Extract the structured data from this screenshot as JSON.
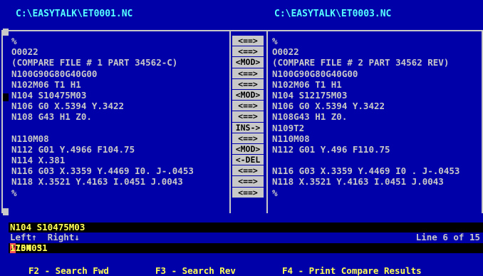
{
  "titles": {
    "left": "C:\\EASYTALK\\ET0001.NC",
    "right": "C:\\EASYTALK\\ET0003.NC"
  },
  "left_lines": [
    "%",
    "O0022",
    "(COMPARE FILE # 1 PART 34562-C)",
    "N100G90G80G40G00",
    "N102M06 T1 H1",
    "N104 S10475M03",
    "N106 G0 X.5394 Y.3422",
    "N108 G43 H1 Z0.",
    "",
    "N110M08",
    "N112 G01 Y.4966 F104.75",
    "N114 X.381",
    "N116 G03 X.3359 Y.4469 I0. J-.0453",
    "N118 X.3521 Y.4163 I.0451 J.0043",
    "%"
  ],
  "compare_markers": [
    "<==>",
    "<==>",
    "<MOD>",
    "<==>",
    "<==>",
    "<MOD>",
    "<==>",
    "<==>",
    "INS->",
    "<==>",
    "<MOD>",
    "<-DEL",
    "<==>",
    "<==>",
    "<==>"
  ],
  "right_lines": [
    "%",
    "O0022",
    "(COMPARE FILE # 2 PART 34562 REV)",
    "N100G90G80G40G00",
    "N102M06 T1 H1",
    "N104 S12175M03",
    "N106 G0 X.5394 Y.3422",
    "N108G43 H1 Z0.",
    "N109T2",
    "N110M08",
    "N112 G01 Y.496 F110.75",
    "",
    "N116 G03 X.3359 Y.4469 I0 . J-.0453",
    "N118 X.3521 Y.4163 I.0451 J.0043",
    "%"
  ],
  "status": {
    "top_line": "N104 S10475M03",
    "hint": "Left↑  Right↓",
    "line_info": "Line 6 of 15",
    "bottom_prefix": "N104 S1",
    "bottom_highlight": "2",
    "bottom_suffix": "175M03"
  },
  "function_keys": {
    "f2": "F2 - Search Fwd",
    "f3": "F3 - Search Rev",
    "f4": "F4 - Print Compare Results"
  },
  "colors": {
    "background": "#0000a8",
    "title": "#55ffff",
    "text": "#c8c8c8",
    "status_text": "#ffff55",
    "highlight": "#ff5555"
  }
}
